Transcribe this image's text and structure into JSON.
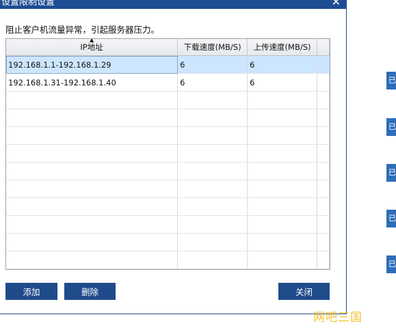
{
  "dialog": {
    "title": "设置限制设置",
    "description": "阻止客户机流量异常，引起服务器压力。"
  },
  "table": {
    "columns": [
      "IP地址",
      "下载速度(MB/S)",
      "上传速度(MB/S)"
    ],
    "rows": [
      [
        "192.168.1.1-192.168.1.29",
        "6",
        "6"
      ],
      [
        "192.168.1.31-192.168.1.40",
        "6",
        "6"
      ]
    ]
  },
  "buttons": {
    "add": "添加",
    "delete": "删除",
    "close": "关闭"
  },
  "side_tabs": [
    "已",
    "已",
    "已",
    "已",
    "已"
  ],
  "watermark": "网吧三国",
  "colors": {
    "title_bar": "#1d4d93",
    "button": "#1f4b8b",
    "selected_row": "#cde6ff",
    "side_tab": "#2f6db8"
  }
}
